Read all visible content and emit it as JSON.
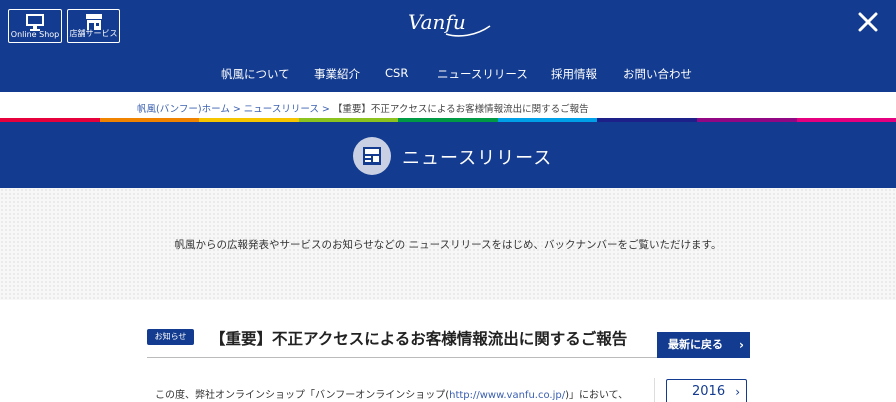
{
  "header": {
    "online_shop_label": "Online Shop",
    "store_service_label": "店舗サービス",
    "logo_text": "Vanfu",
    "nav": [
      "帆風について",
      "事業紹介",
      "CSR",
      "ニュースリリース",
      "採用情報",
      "お問い合わせ"
    ]
  },
  "breadcrumb": {
    "home": "帆風(バンフー)ホーム",
    "news": "ニュースリリース",
    "current": "【重要】不正アクセスによるお客様情報流出に関するご報告",
    "separator": ">"
  },
  "stripe_colors": [
    "#e6003c",
    "#f08300",
    "#f7c400",
    "#8cc31e",
    "#009944",
    "#00a0e9",
    "#1d2088",
    "#920783",
    "#e4007f"
  ],
  "page_title": "ニュースリリース",
  "intro": "帆風からの広報発表やサービスのお知らせなどの ニュースリリースをはじめ、バックナンバーをご覧いただけます。",
  "article": {
    "badge": "お知らせ",
    "headline": "【重要】不正アクセスによるお客様情報流出に関するご報告",
    "latest_button": "最新に戻る",
    "body_prefix": "この度、弊社オンラインショップ「バンフーオンラインショップ(",
    "body_link": "http://www.vanfu.co.jp/",
    "body_suffix": ")」において、"
  },
  "archive": {
    "year": "2016"
  },
  "colors": {
    "brand_blue": "#133b8f",
    "link_blue": "#3a5fb0"
  }
}
